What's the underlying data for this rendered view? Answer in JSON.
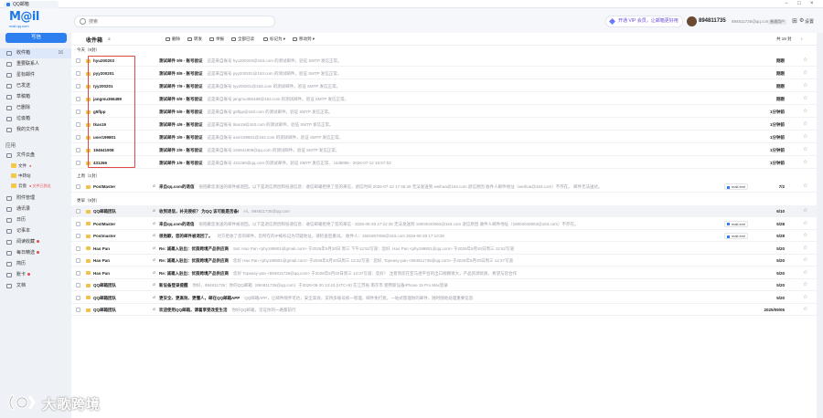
{
  "browser": {
    "tab_title": "QQ邮箱"
  },
  "header": {
    "logo_text": "M@il",
    "logo_sub": "mail.qq.com",
    "search_placeholder": "搜索",
    "vip_text": "开通 VIP 会员，让邮箱更好用",
    "user_name": "894811735",
    "user_email": "894811735@qq.com",
    "user_badge": "普通用户",
    "settings_label": "设置"
  },
  "sidebar": {
    "write_label": "写信",
    "items": [
      {
        "label": "收件箱",
        "count": "16",
        "active": true
      },
      {
        "label": "重要联系人",
        "count": ""
      },
      {
        "label": "星标邮件",
        "count": ""
      },
      {
        "label": "已发送",
        "count": ""
      },
      {
        "label": "草稿箱",
        "count": ""
      },
      {
        "label": "已删除",
        "count": ""
      },
      {
        "label": "垃圾箱",
        "count": ""
      },
      {
        "label": "我的文件夹",
        "count": ""
      }
    ],
    "apps_title": "应用",
    "file_center": "文件云盘",
    "folders": [
      {
        "label": "文件",
        "tag": "●"
      },
      {
        "label": "中转站",
        "tag": ""
      },
      {
        "label": "云盘",
        "tag": "● 文件已到达"
      }
    ],
    "apps": [
      {
        "label": "附件管理",
        "dot": false
      },
      {
        "label": "通讯录",
        "dot": false
      },
      {
        "label": "日历",
        "dot": false
      },
      {
        "label": "记事本",
        "dot": false
      },
      {
        "label": "阅读收藏",
        "dot": true
      },
      {
        "label": "每日精选",
        "dot": true
      },
      {
        "label": "简历",
        "dot": false
      },
      {
        "label": "账卡",
        "dot": true
      },
      {
        "label": "文档",
        "dot": false
      }
    ]
  },
  "toolbar": {
    "title": "收件箱",
    "buttons": [
      "删除",
      "转发",
      "举报",
      "全部已读",
      "标记为",
      "移动到"
    ],
    "page_info": "共 19 封"
  },
  "groups": {
    "today": "今天（9封）",
    "yesterday": "上周（1封）",
    "earlier": "更早（9封）"
  },
  "today_rows": [
    {
      "sender": "hyu200203",
      "subject": "测试邮件 9/9 - 账号验证",
      "preview": "这是来自账号 hyu200203@163.com 的测试邮件。验证 SMTP 发信正常。",
      "date": "刚刚"
    },
    {
      "sender": "pyy200201",
      "subject": "测试邮件 8/9 - 账号验证",
      "preview": "这是来自账号 pyy200201@163.com 的测试邮件。验证 SMTP 发信正常。",
      "date": "刚刚"
    },
    {
      "sender": "tyy200201",
      "subject": "测试邮件 7/9 - 账号验证",
      "preview": "这是来自账号 tyy200201@163.com 的测试邮件。验证 SMTP 发信正常。",
      "date": "刚刚"
    },
    {
      "sender": "jangmu366489",
      "subject": "测试邮件 6/9 - 账号验证",
      "preview": "这是来自账号 jangmu366489@163.com 的测试邮件。验证 SMTP 发信正常。",
      "date": "刚刚"
    },
    {
      "sender": "g5flpp",
      "subject": "测试邮件 5/9 - 账号验证",
      "preview": "这是来自账号 g5flpp@163.com 的测试邮件。验证 SMTP 发信正常。",
      "date": "1分钟前"
    },
    {
      "sender": "tkas19",
      "subject": "测试邮件 4/9 - 账号验证",
      "preview": "这是来自账号 tkas19@163.com 的测试邮件。验证 SMTP 发信正常。",
      "date": "1分钟前"
    },
    {
      "sender": "user199801",
      "subject": "测试邮件 3/9 - 账号验证",
      "preview": "这是来自账号 user199801@163.com 的测试邮件。验证 SMTP 发信正常。",
      "date": "1分钟前"
    },
    {
      "sender": "194641908",
      "subject": "测试邮件 2/9 - 账号验证",
      "preview": "这是来自账号 194641908@qq.com 的测试邮件。验证 SMTP 发信正常。",
      "date": "1分钟前"
    },
    {
      "sender": "431266",
      "subject": "测试邮件 1/9 - 账号验证",
      "preview": "这是来自账号 431266@qq.com 的测试邮件。验证 SMTP 发信正常。 Uid8895 - 2026-07-12 16:57:53",
      "date": "1分钟前"
    }
  ],
  "yesterday_rows": [
    {
      "sender": "PostMaster",
      "subject": "来自qq.com的退信",
      "preview": "很抱歉您发送的邮件被退回。以下是退信原因和投递信息：收信邮箱拒绝了您的来信，退信时间 2026-07-12 17:46:28 无法发送到 weihua@163.com 退信原因 收件人邮件地址（weihua@163.com）不存在。 邮件无法送达。",
      "att": "mail.eml",
      "date": "7/2"
    }
  ],
  "earlier_rows": [
    {
      "sender": "QQ邮箱团队",
      "subject": "收到退信，补充授权？ 为QQ 该可能是否备!",
      "preview": "Hi，894811735@qq.com",
      "att": "",
      "date": "6/10"
    },
    {
      "sender": "PostMaster",
      "subject": "来自qq.com的退信",
      "preview": "很抱歉您发送的邮件被退回。以下是退信原因和投递信息：收信邮箱拒绝了您的来信 - 2026-05-28 17:22:36 无法发送到 18004040063@163.com 退信原因 收件人邮件地址（18004040063@163.com）不存在。",
      "att": "mail.eml",
      "date": "5/28"
    },
    {
      "sender": "Postmaster",
      "subject": "很抱歉，您的邮件被退回了。",
      "preview": "对方拒收了您的邮件。您所在的IP被标记为可疑地址，请检查后重试。 收件人：1591867006@163.com 2026-05-28 17:10:28",
      "att": "mail.eml",
      "date": "5/28"
    },
    {
      "sender": "Hao Pan",
      "subject": "Re: 诚邀入驻出：优质跨境产品供应商",
      "preview": "Sat: Hao Pan <phy199801@gmail.com> 于2026年5月20日 周三 下午12:52写道：您好, Hao Pan <phy199801@qq.com> 于2026年5月20日周三 12:52写道",
      "att": "",
      "date": "5/20"
    },
    {
      "sender": "Hao Pan",
      "subject": "Re: 诚邀入驻出：优质跨境产品供应商",
      "preview": "您好 Hao Pan <phy199801@gmail.com> 于2026年5月20日周三 12:32写道：您好, Topeasy-pan <894811735@qq.com> 于2026年5月20日周三 12:27写道",
      "att": "",
      "date": "5/20"
    },
    {
      "sender": "Hao Pan",
      "subject": "Re: 诚邀入驻出：优质跨境产品供应商",
      "preview": "您好 Topeasy-pan <894811735@qq.com> 于2026年5月20日周三 13:37写道：您好！ 注意到您在亚马逊平台的出口规模很大，产品资源优质，希望与您合作",
      "att": "",
      "date": "5/20"
    },
    {
      "sender": "QQ邮箱团队",
      "subject": "新设备登录提醒",
      "preview": "你好，894811735：你的QQ邮箱（894811735@qq.com）于2026-05-20 13:43 (UTC+8) 在江苏省 南京市 使用新设备iPhone 15 Pro Max登录",
      "att": "",
      "date": "5/20"
    },
    {
      "sender": "QQ邮箱团队",
      "subject": "更安全、更高效、更懂人，邮在QQ邮箱APP",
      "preview": "QQ邮箱APP，让邮件随手可达，安全高效，支持多账号统一管理，邮件免打扰，一站式管理你的邮件，随时随地处理重要信息",
      "att": "",
      "date": "5/20"
    },
    {
      "sender": "QQ邮箱团队",
      "subject": "欢迎使用QQ邮箱，请着享受改变生活",
      "preview": "你好QQ邮箱，见证你的一路都前行",
      "att": "",
      "date": "2025/09/05"
    }
  ],
  "watermark": {
    "text": "大歌跨境"
  }
}
